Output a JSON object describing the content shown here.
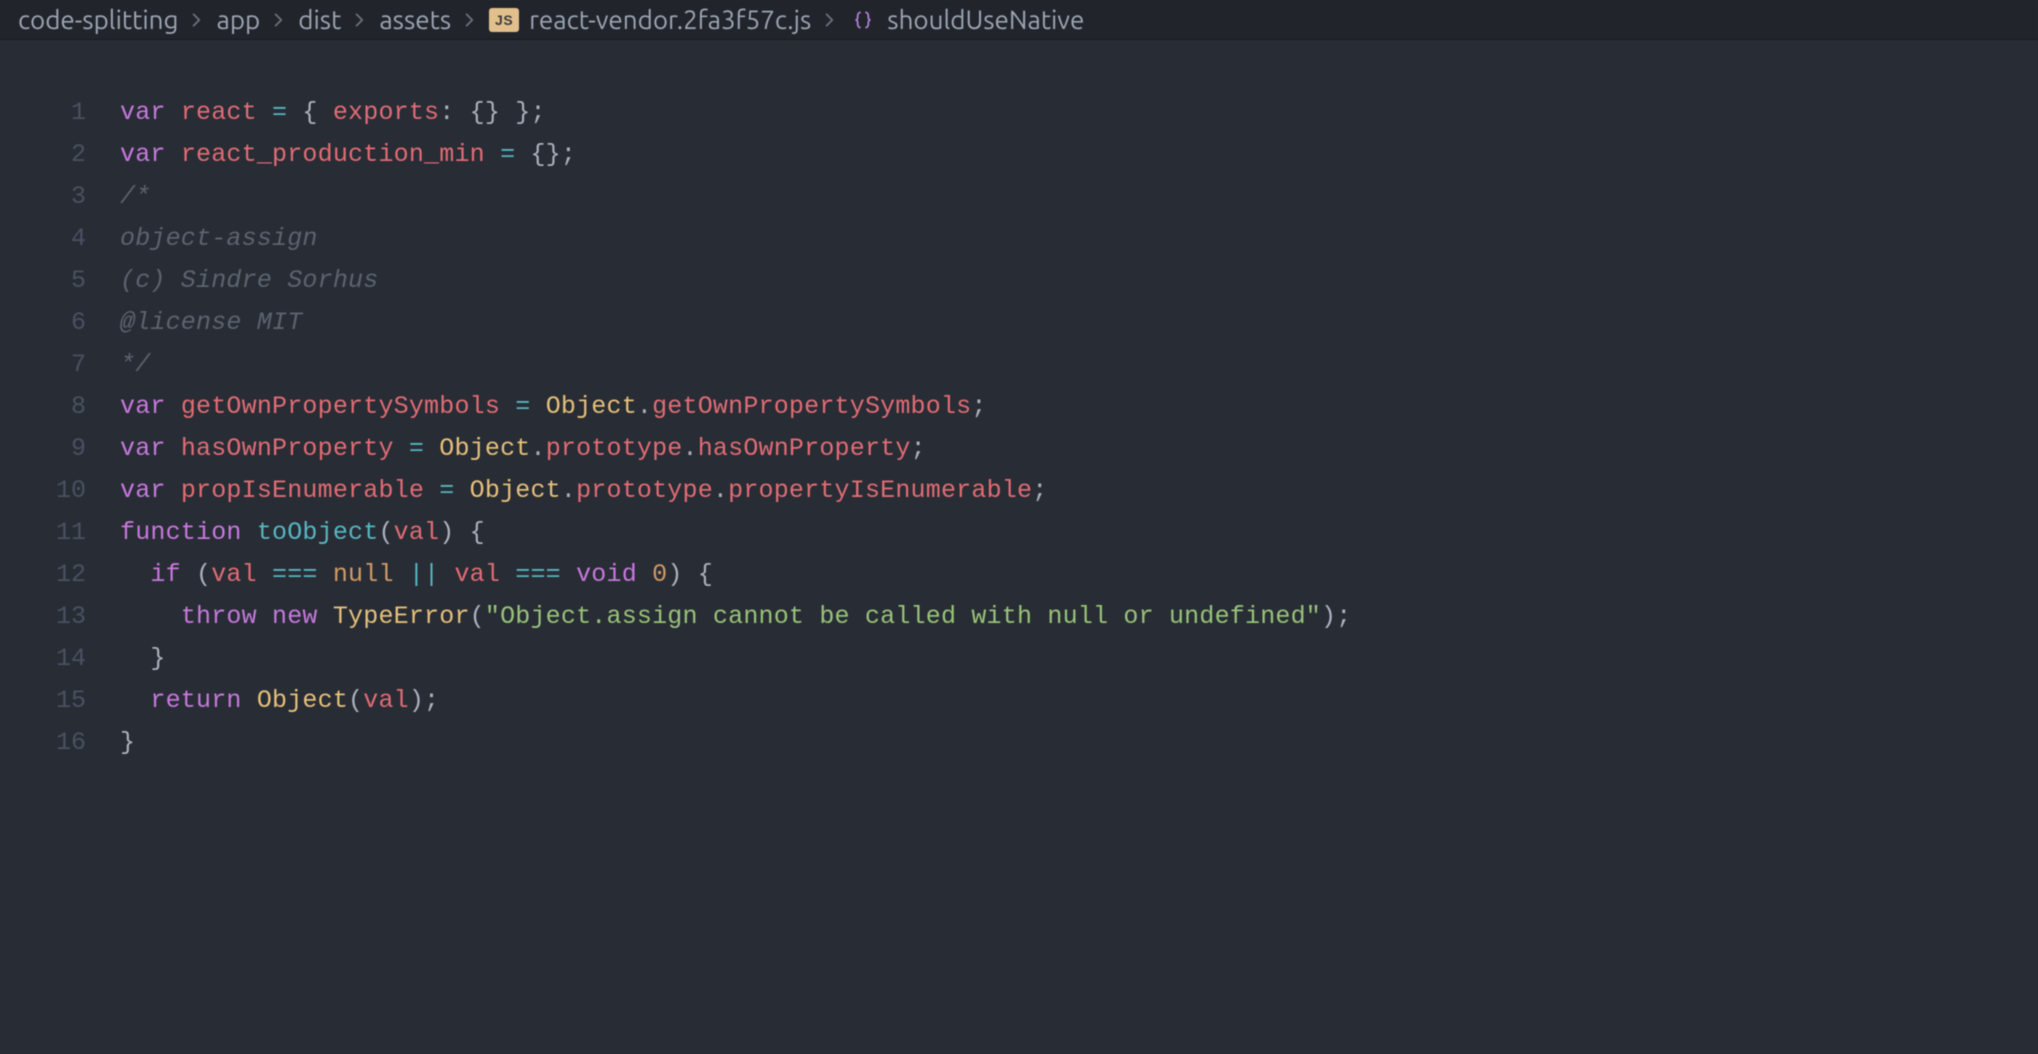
{
  "breadcrumb": {
    "items": [
      {
        "label": "code-splitting",
        "kind": "folder"
      },
      {
        "label": "app",
        "kind": "folder"
      },
      {
        "label": "dist",
        "kind": "folder"
      },
      {
        "label": "assets",
        "kind": "folder"
      },
      {
        "label": "react-vendor.2fa3f57c.js",
        "kind": "file-js"
      },
      {
        "label": "shouldUseNative",
        "kind": "symbol-fn"
      }
    ]
  },
  "icons": {
    "js_badge": "JS"
  },
  "editor": {
    "first_line": 1,
    "last_line": 16,
    "lines": [
      [
        {
          "cls": "kw",
          "t": "var"
        },
        {
          "cls": "pn",
          "t": " "
        },
        {
          "cls": "id",
          "t": "react"
        },
        {
          "cls": "pn",
          "t": " "
        },
        {
          "cls": "op",
          "t": "="
        },
        {
          "cls": "pn",
          "t": " { "
        },
        {
          "cls": "pr",
          "t": "exports"
        },
        {
          "cls": "pn",
          "t": ": {} };"
        }
      ],
      [
        {
          "cls": "kw",
          "t": "var"
        },
        {
          "cls": "pn",
          "t": " "
        },
        {
          "cls": "id",
          "t": "react_production_min"
        },
        {
          "cls": "pn",
          "t": " "
        },
        {
          "cls": "op",
          "t": "="
        },
        {
          "cls": "pn",
          "t": " {};"
        }
      ],
      [
        {
          "cls": "cm",
          "t": "/*"
        }
      ],
      [
        {
          "cls": "cm",
          "t": "object-assign"
        }
      ],
      [
        {
          "cls": "cm",
          "t": "(c) Sindre Sorhus"
        }
      ],
      [
        {
          "cls": "cm",
          "t": "@license MIT"
        }
      ],
      [
        {
          "cls": "cm",
          "t": "*/"
        }
      ],
      [
        {
          "cls": "kw",
          "t": "var"
        },
        {
          "cls": "pn",
          "t": " "
        },
        {
          "cls": "id",
          "t": "getOwnPropertySymbols"
        },
        {
          "cls": "pn",
          "t": " "
        },
        {
          "cls": "op",
          "t": "="
        },
        {
          "cls": "pn",
          "t": " "
        },
        {
          "cls": "id2",
          "t": "Object"
        },
        {
          "cls": "pn",
          "t": "."
        },
        {
          "cls": "pr",
          "t": "getOwnPropertySymbols"
        },
        {
          "cls": "pn",
          "t": ";"
        }
      ],
      [
        {
          "cls": "kw",
          "t": "var"
        },
        {
          "cls": "pn",
          "t": " "
        },
        {
          "cls": "id",
          "t": "hasOwnProperty"
        },
        {
          "cls": "pn",
          "t": " "
        },
        {
          "cls": "op",
          "t": "="
        },
        {
          "cls": "pn",
          "t": " "
        },
        {
          "cls": "id2",
          "t": "Object"
        },
        {
          "cls": "pn",
          "t": "."
        },
        {
          "cls": "pr",
          "t": "prototype"
        },
        {
          "cls": "pn",
          "t": "."
        },
        {
          "cls": "pr",
          "t": "hasOwnProperty"
        },
        {
          "cls": "pn",
          "t": ";"
        }
      ],
      [
        {
          "cls": "kw",
          "t": "var"
        },
        {
          "cls": "pn",
          "t": " "
        },
        {
          "cls": "id",
          "t": "propIsEnumerable"
        },
        {
          "cls": "pn",
          "t": " "
        },
        {
          "cls": "op",
          "t": "="
        },
        {
          "cls": "pn",
          "t": " "
        },
        {
          "cls": "id2",
          "t": "Object"
        },
        {
          "cls": "pn",
          "t": "."
        },
        {
          "cls": "pr",
          "t": "prototype"
        },
        {
          "cls": "pn",
          "t": "."
        },
        {
          "cls": "pr",
          "t": "propertyIsEnumerable"
        },
        {
          "cls": "pn",
          "t": ";"
        }
      ],
      [
        {
          "cls": "kw",
          "t": "function"
        },
        {
          "cls": "pn",
          "t": " "
        },
        {
          "cls": "fn",
          "t": "toObject"
        },
        {
          "cls": "pn",
          "t": "("
        },
        {
          "cls": "id",
          "t": "val"
        },
        {
          "cls": "pn",
          "t": ") {"
        }
      ],
      [
        {
          "cls": "pn",
          "t": "  "
        },
        {
          "cls": "kw",
          "t": "if"
        },
        {
          "cls": "pn",
          "t": " ("
        },
        {
          "cls": "id",
          "t": "val"
        },
        {
          "cls": "pn",
          "t": " "
        },
        {
          "cls": "op",
          "t": "==="
        },
        {
          "cls": "pn",
          "t": " "
        },
        {
          "cls": "nm",
          "t": "null"
        },
        {
          "cls": "pn",
          "t": " "
        },
        {
          "cls": "op",
          "t": "||"
        },
        {
          "cls": "pn",
          "t": " "
        },
        {
          "cls": "id",
          "t": "val"
        },
        {
          "cls": "pn",
          "t": " "
        },
        {
          "cls": "op",
          "t": "==="
        },
        {
          "cls": "pn",
          "t": " "
        },
        {
          "cls": "kw",
          "t": "void"
        },
        {
          "cls": "pn",
          "t": " "
        },
        {
          "cls": "nm",
          "t": "0"
        },
        {
          "cls": "pn",
          "t": ") {"
        }
      ],
      [
        {
          "cls": "pn",
          "t": "    "
        },
        {
          "cls": "kw",
          "t": "throw"
        },
        {
          "cls": "pn",
          "t": " "
        },
        {
          "cls": "kw",
          "t": "new"
        },
        {
          "cls": "pn",
          "t": " "
        },
        {
          "cls": "id2",
          "t": "TypeError"
        },
        {
          "cls": "pn",
          "t": "("
        },
        {
          "cls": "str",
          "t": "\"Object.assign cannot be called with null or undefined\""
        },
        {
          "cls": "pn",
          "t": ");"
        }
      ],
      [
        {
          "cls": "pn",
          "t": "  }"
        }
      ],
      [
        {
          "cls": "pn",
          "t": "  "
        },
        {
          "cls": "kw",
          "t": "return"
        },
        {
          "cls": "pn",
          "t": " "
        },
        {
          "cls": "id2",
          "t": "Object"
        },
        {
          "cls": "pn",
          "t": "("
        },
        {
          "cls": "id",
          "t": "val"
        },
        {
          "cls": "pn",
          "t": ");"
        }
      ],
      [
        {
          "cls": "pn",
          "t": "}"
        }
      ]
    ]
  }
}
